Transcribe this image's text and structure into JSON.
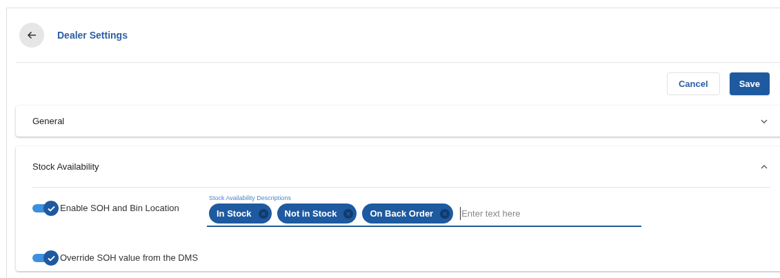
{
  "header": {
    "title": "Dealer Settings"
  },
  "actions": {
    "cancel": "Cancel",
    "save": "Save"
  },
  "panels": [
    {
      "title": "General",
      "expanded": false
    },
    {
      "title": "Stock Availability",
      "expanded": true
    }
  ],
  "stock_availability": {
    "toggles": [
      {
        "label": "Enable SOH and Bin Location",
        "on": true
      },
      {
        "label": "Override SOH value from the DMS",
        "on": true
      }
    ],
    "descriptions_field": {
      "label": "Stock Availability Descriptions",
      "chips": [
        "In Stock",
        "Not in Stock",
        "On Back Order"
      ],
      "placeholder": "Enter text here"
    }
  }
}
